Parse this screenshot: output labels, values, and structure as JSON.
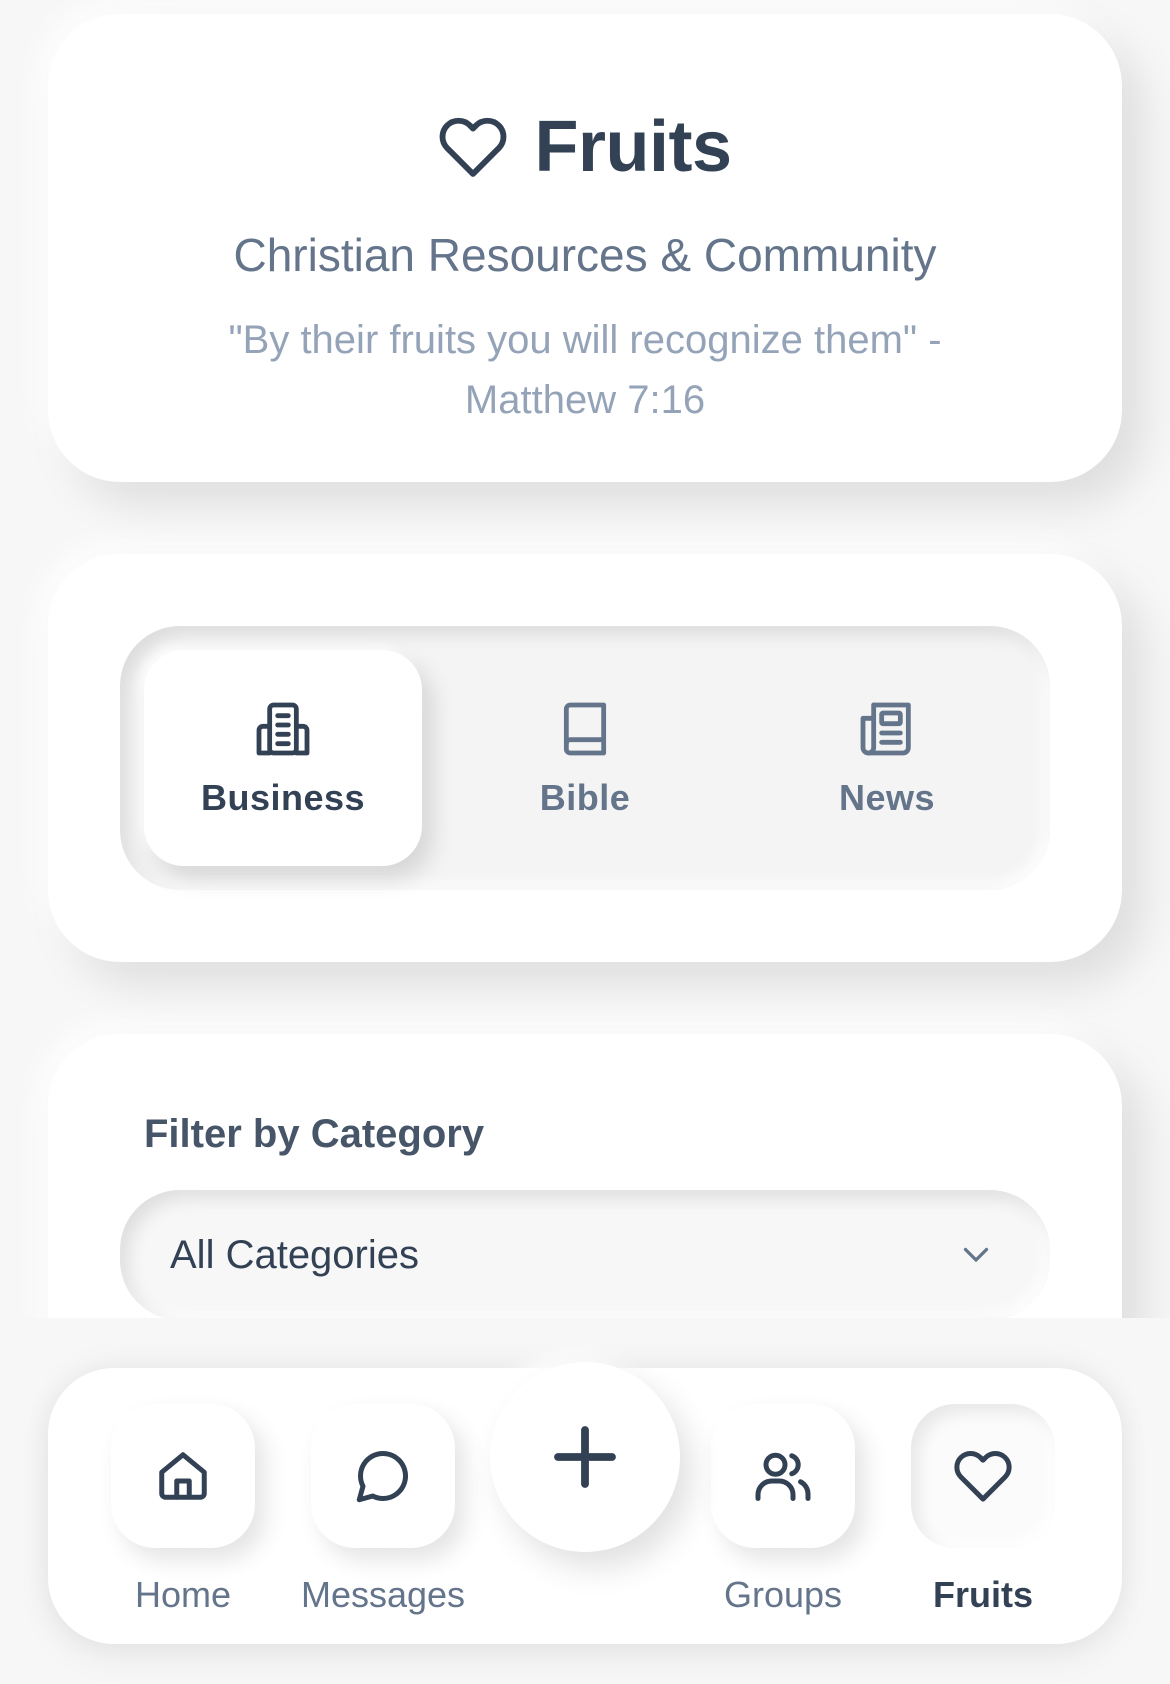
{
  "header": {
    "title": "Fruits",
    "icon": "heart-icon",
    "subtitle": "Christian Resources & Community",
    "quote": "\"By their fruits you will recognize them\" - Matthew 7:16"
  },
  "tabs": [
    {
      "label": "Business",
      "icon": "building-icon",
      "active": true
    },
    {
      "label": "Bible",
      "icon": "book-icon",
      "active": false
    },
    {
      "label": "News",
      "icon": "newspaper-icon",
      "active": false
    }
  ],
  "filter": {
    "title": "Filter by Category",
    "selected": "All Categories",
    "icon": "chevron-down-icon"
  },
  "bottom_nav": {
    "items": [
      {
        "label": "Home",
        "icon": "home-icon",
        "active": false
      },
      {
        "label": "Messages",
        "icon": "message-icon",
        "active": false
      },
      {
        "label": "Groups",
        "icon": "users-icon",
        "active": false
      },
      {
        "label": "Fruits",
        "icon": "heart-icon",
        "active": true
      }
    ],
    "fab_icon": "plus-icon"
  },
  "colors": {
    "text_primary": "#334155",
    "text_secondary": "#64748b",
    "text_muted": "#94a3b8",
    "background": "#f7f7f7",
    "card": "#ffffff"
  }
}
